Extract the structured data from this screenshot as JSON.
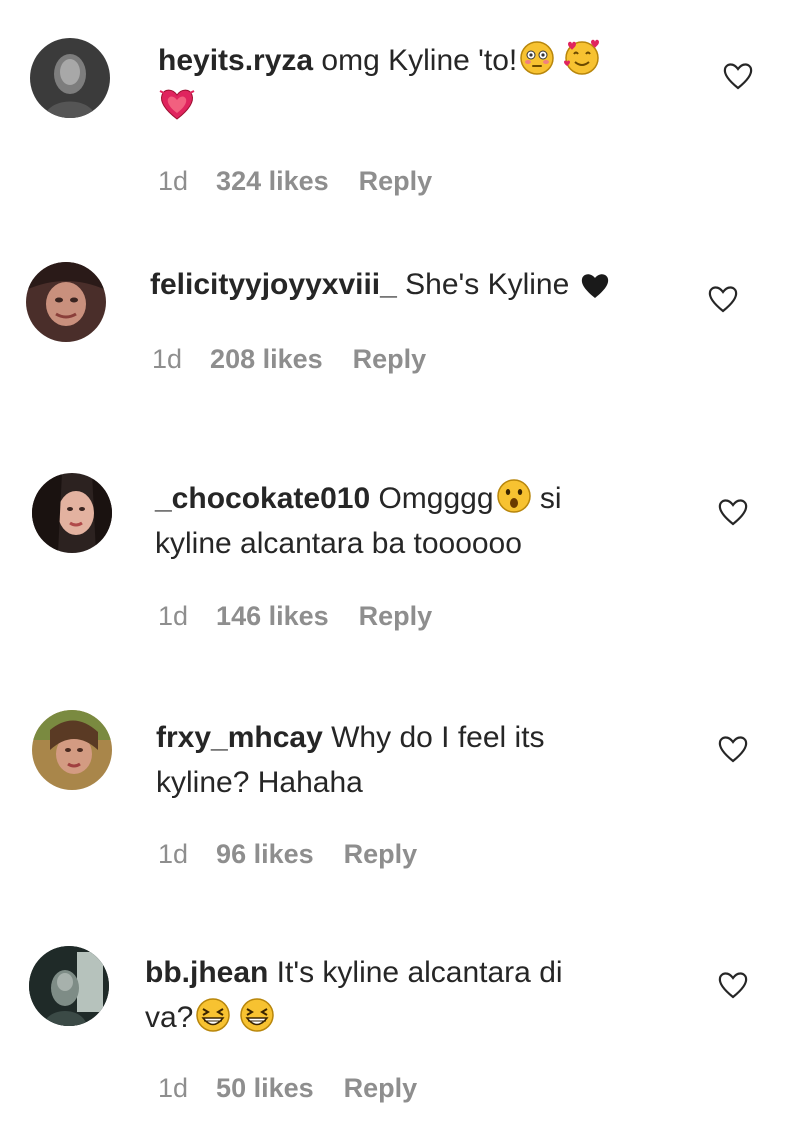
{
  "comments": [
    {
      "username": "heyits.ryza",
      "text_line1": " omg Kyline 'to!",
      "text_line2": "",
      "emojis_line1": [
        "flushed-face-emoji",
        "smiling-face-hearts-emoji"
      ],
      "emojis_line2": [
        "growing-heart-emoji"
      ],
      "time": "1d",
      "likes": "324 likes",
      "reply": "Reply"
    },
    {
      "username": "felicityyjoyyxviii_",
      "text_line1": " She's Kyline ",
      "text_line2": "",
      "emojis_line1": [
        "black-heart-emoji"
      ],
      "emojis_line2": [],
      "time": "1d",
      "likes": "208 likes",
      "reply": "Reply"
    },
    {
      "username": "_chocokate010",
      "text_line1": " Omgggg",
      "text_line1_after": " si",
      "text_line2": "kyline alcantara ba toooooo",
      "emojis_line1": [
        "astonished-face-emoji"
      ],
      "emojis_line2": [],
      "time": "1d",
      "likes": "146 likes",
      "reply": "Reply"
    },
    {
      "username": "frxy_mhcay",
      "text_line1": " Why do I feel its",
      "text_line2": "kyline? Hahaha",
      "emojis_line1": [],
      "emojis_line2": [],
      "time": "1d",
      "likes": "96 likes",
      "reply": "Reply"
    },
    {
      "username": "bb.jhean",
      "text_line1": " It's kyline alcantara di",
      "text_line2": "va?",
      "emojis_line1": [],
      "emojis_line2": [
        "grinning-squinting-face-emoji",
        "grinning-squinting-face-emoji"
      ],
      "time": "1d",
      "likes": "50 likes",
      "reply": "Reply"
    }
  ],
  "colors": {
    "text": "#262626",
    "meta": "#8e8e8e",
    "heart_outline": "#262626",
    "emoji_yellow": "#f7c231",
    "emoji_red": "#e0245e"
  }
}
